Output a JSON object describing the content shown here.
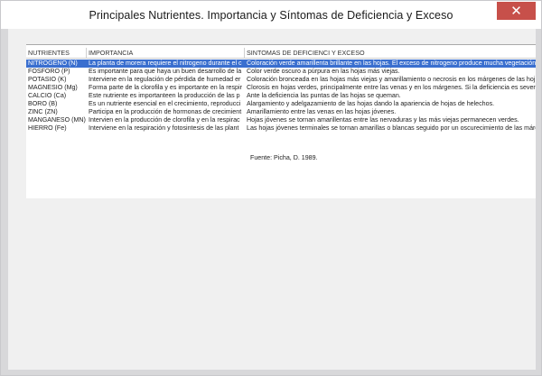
{
  "window": {
    "title": "Principales Nutrientes. Importancia y Síntomas de Deficiencia y Exceso",
    "close_glyph": "✕"
  },
  "table": {
    "columns": [
      "NUTRIENTES",
      "IMPORTANCIA",
      "SINTOMAS DE DEFICIENCI Y EXCESO"
    ],
    "rows": [
      {
        "nutrient": "NITROGENO (N)",
        "importance": "La planta de morera requiere el nitrogeno durante el c",
        "symptoms": "Coloración verde amarillenta brillante en las hojas. El exceso de nitrogeno produce mucha vegetación"
      },
      {
        "nutrient": "FOSFORO (P)",
        "importance": "Es importante para que haya un buen desarrollo de la",
        "symptoms": "Color verde oscuro a púrpura en las hojas más viejas."
      },
      {
        "nutrient": "POTASIO (K)",
        "importance": "Interviene en la regulación de pérdida de humedad er",
        "symptoms": "Coloración bronceada en las hojas más viejas y amarillamiento o necrosis en los márgenes de las hoj"
      },
      {
        "nutrient": "MAGNESIO (Mg)",
        "importance": "Forma parte de la clorofila y es importante en la respir",
        "symptoms": "Clorosis en hojas verdes, principalmente entre las venas y en los márgenes. Si la deficiencia es sever"
      },
      {
        "nutrient": "CALCIO (Ca)",
        "importance": "Este nutriente es importanteen la producción de las p",
        "symptoms": "Ante la deficiencia las puntas de las hojas se queman."
      },
      {
        "nutrient": "BORO (B)",
        "importance": "Es un nutriente esencial en el crecimiento, reproducci",
        "symptoms": "Alargamiento y adelgazamiento de las hojas dando la apariencia de hojas de helechos."
      },
      {
        "nutrient": "ZINC (ZN)",
        "importance": "Participa en la producción de hormonas de crecimient",
        "symptoms": "Amarillamiento entre las venas en las hojas jóvenes."
      },
      {
        "nutrient": "MANGANESO (MN)",
        "importance": "Intervien en la producción de clorofila y en la respirac",
        "symptoms": "Hojas jóvenes se tornan amarillentas entre las nervaduras y las más viejas permanecen verdes."
      },
      {
        "nutrient": "HIERRO (Fe)",
        "importance": "Interviene en la respiración y fotosintesis de las plant",
        "symptoms": "Las hojas jóvenes terminales se tornan amarillas o blancas seguido por un oscurecimiento de las márg"
      }
    ],
    "source": "Fuente: Picha, D. 1989."
  }
}
